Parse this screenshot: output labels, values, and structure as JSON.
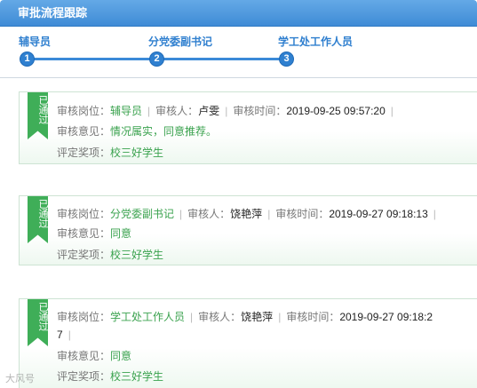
{
  "window": {
    "title": "审批流程跟踪"
  },
  "steps": [
    {
      "number": "1",
      "label": "辅导员"
    },
    {
      "number": "2",
      "label": "分党委副书记"
    },
    {
      "number": "3",
      "label": "学工处工作人员"
    }
  ],
  "labels": {
    "position": "审核岗位：",
    "reviewer": "审核人：",
    "time": "审核时间：",
    "opinion": "审核意见：",
    "award": "评定奖项："
  },
  "records": [
    {
      "status": "已通过",
      "position": "辅导员",
      "reviewer": "卢雯",
      "time": "2019-09-25 09:57:20",
      "opinion": "情况属实，同意推荐。",
      "award": "校三好学生"
    },
    {
      "status": "已通过",
      "position": "分党委副书记",
      "reviewer": "饶艳萍",
      "time": "2019-09-27 09:18:13",
      "opinion": "同意",
      "award": "校三好学生"
    },
    {
      "status": "已通过",
      "position": "学工处工作人员",
      "reviewer": "饶艳萍",
      "time": "2019-09-27 09:18:2",
      "time_wrap": "7",
      "opinion": "同意",
      "award": "校三好学生"
    }
  ],
  "watermark": "大风号"
}
